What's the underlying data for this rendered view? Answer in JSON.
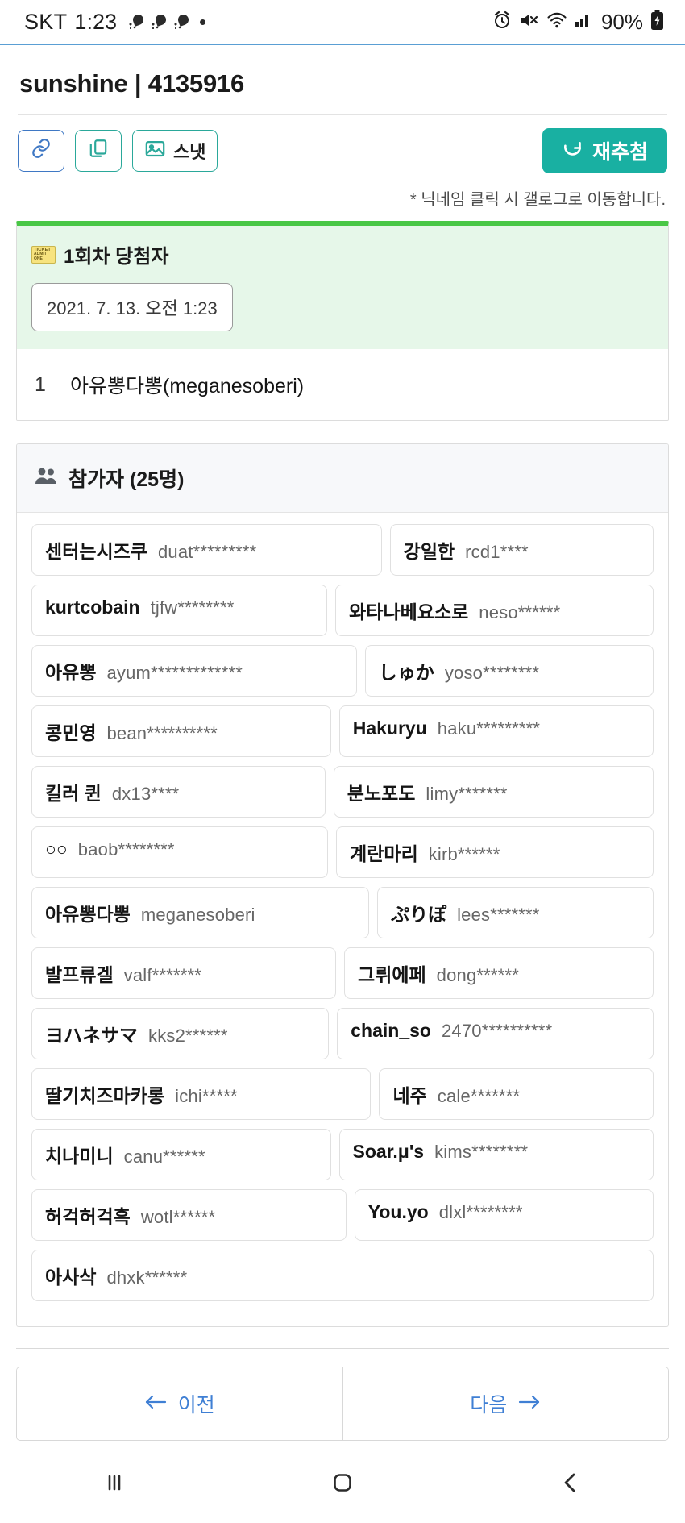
{
  "statusbar": {
    "carrier": "SKT",
    "clock": "1:23",
    "battery_percent": "90%",
    "icons": [
      "comet-icon",
      "comet-icon",
      "comet-icon",
      "dot-icon",
      "alarm-icon",
      "mute-icon",
      "wifi-icon",
      "signal-icon",
      "battery-charging-icon"
    ]
  },
  "header": {
    "title": "sunshine | 4135916",
    "buttons": {
      "link": "link-icon",
      "copy": "copy-icon",
      "snapshot_label": "스냇",
      "snapshot_icon": "image-icon",
      "redraw_label": "재추첨",
      "redraw_icon": "refresh-icon"
    },
    "hint": "* 닉네임 클릭 시 갤로그로 이동합니다."
  },
  "winner": {
    "heading": "1회차 당첨자",
    "heading_icon": "ticket-icon",
    "date": "2021. 7. 13. 오전 1:23",
    "rows": [
      {
        "rank": "1",
        "name": "아유뽕다뽕(meganesoberi)"
      }
    ]
  },
  "participants": {
    "heading": "참가자 (25명)",
    "heading_icon": "users-icon",
    "rows": [
      [
        {
          "nick": "센터는시즈쿠",
          "id": "duat*********",
          "grow": true
        },
        {
          "nick": "강일한",
          "id": "rcd1****",
          "grow": true
        }
      ],
      [
        {
          "nick": "kurtcobain",
          "id": "tjfw********",
          "grow": true
        },
        {
          "nick": "와타나베요소로",
          "id": "neso******",
          "grow": true
        }
      ],
      [
        {
          "nick": "아유뽕",
          "id": "ayum*************",
          "grow": true
        },
        {
          "nick": "しゅか",
          "id": "yoso********",
          "grow": true
        }
      ],
      [
        {
          "nick": "콩민영",
          "id": "bean**********",
          "grow": true
        },
        {
          "nick": "Hakuryu",
          "id": "haku*********",
          "grow": true
        }
      ],
      [
        {
          "nick": "킬러 퀸",
          "id": "dx13****",
          "grow": true
        },
        {
          "nick": "분노포도",
          "id": "limy*******",
          "grow": true
        }
      ],
      [
        {
          "nick": "○○",
          "id": "baob********",
          "grow": true
        },
        {
          "nick": "계란마리",
          "id": "kirb******",
          "grow": true
        }
      ],
      [
        {
          "nick": "아유뽕다뽕",
          "id": "meganesoberi",
          "grow": true
        },
        {
          "nick": "ぷりぽ",
          "id": "lees*******",
          "grow": true
        }
      ],
      [
        {
          "nick": "발프류겔",
          "id": "valf*******",
          "grow": true
        },
        {
          "nick": "그뤼에페",
          "id": "dong******",
          "grow": true
        }
      ],
      [
        {
          "nick": "ヨハネサマ",
          "id": "kks2******",
          "grow": true
        },
        {
          "nick": "chain_so",
          "id": "2470**********",
          "grow": true
        }
      ],
      [
        {
          "nick": "딸기치즈마카롱",
          "id": "ichi*****",
          "grow": true
        },
        {
          "nick": "네주",
          "id": "cale*******",
          "grow": true
        }
      ],
      [
        {
          "nick": "치나미니",
          "id": "canu******",
          "grow": true
        },
        {
          "nick": "Soar.μ's",
          "id": "kims********",
          "grow": true
        }
      ],
      [
        {
          "nick": "허걱허걱흑",
          "id": "wotl******",
          "grow": true
        },
        {
          "nick": "You.yo",
          "id": "dlxl********",
          "grow": true
        }
      ],
      [
        {
          "nick": "아사삭",
          "id": "dhxk******",
          "grow": true
        }
      ]
    ]
  },
  "pager": {
    "prev": "이전",
    "next": "다음"
  },
  "navbar": {
    "recents": "recents-icon",
    "home": "home-icon",
    "back": "back-icon"
  }
}
